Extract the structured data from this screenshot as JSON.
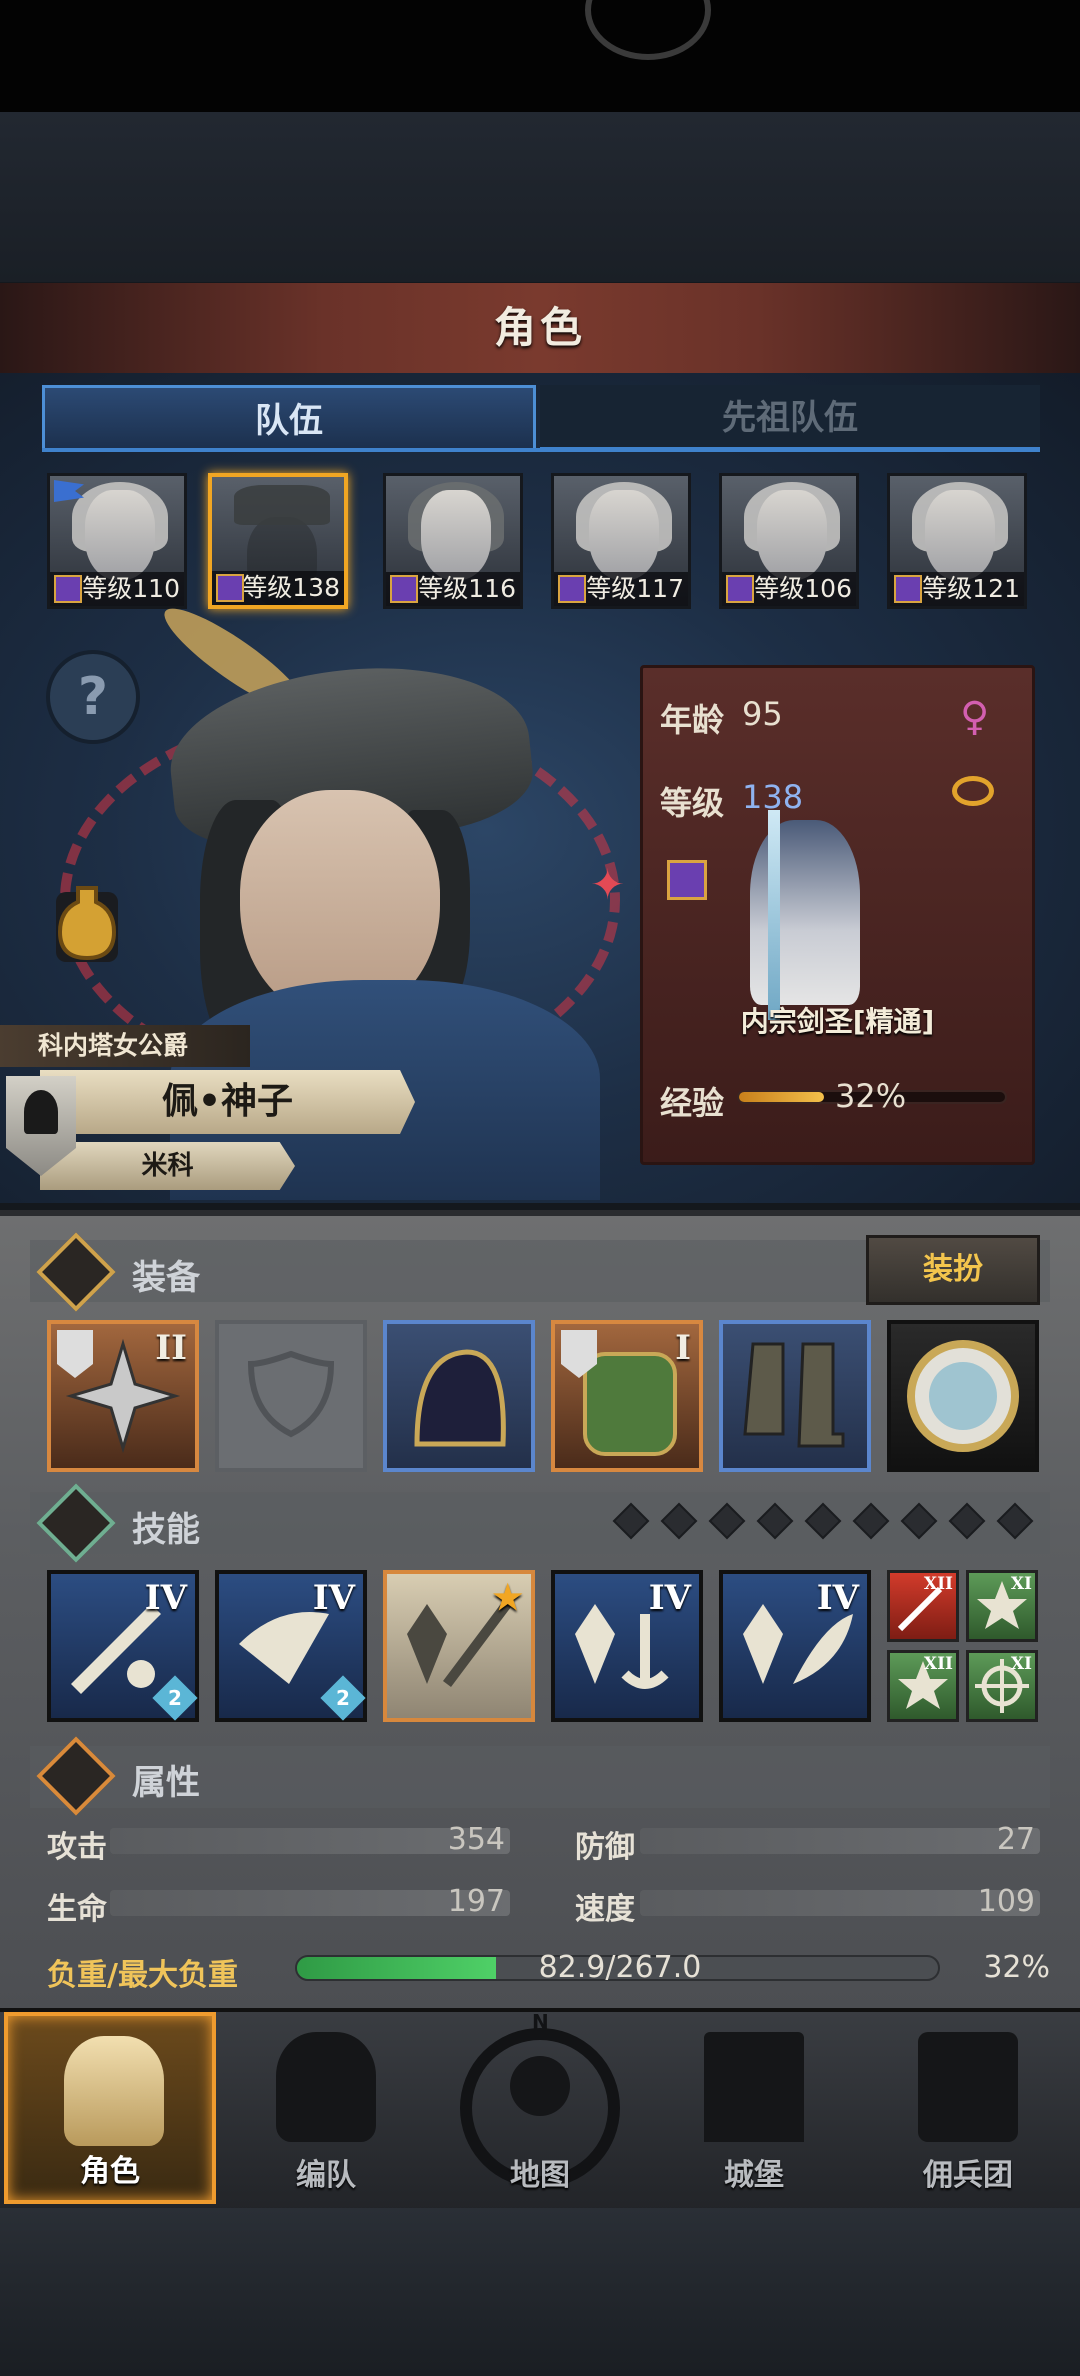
{
  "header": {
    "title": "角色"
  },
  "tabs": [
    {
      "label": "队伍",
      "active": true
    },
    {
      "label": "先祖队伍",
      "active": false
    }
  ],
  "roster": [
    {
      "level_text": "等级110",
      "selected": false,
      "flag": true
    },
    {
      "level_text": "等级138",
      "selected": true,
      "flag": false
    },
    {
      "level_text": "等级116",
      "selected": false,
      "flag": false
    },
    {
      "level_text": "等级117",
      "selected": false,
      "flag": false
    },
    {
      "level_text": "等级106",
      "selected": false,
      "flag": false
    },
    {
      "level_text": "等级121",
      "selected": false,
      "flag": false
    }
  ],
  "hero": {
    "title": "科内塔女公爵",
    "name": "佩•神子",
    "family": "米科",
    "help_icon": "?",
    "spark": "✦"
  },
  "info": {
    "age_label": "年龄",
    "age": "95",
    "gender_icon": "♀",
    "level_label": "等级",
    "level": "138",
    "class_name": "内宗剑圣[精通]",
    "exp_label": "经验",
    "exp_percent": "32%",
    "exp_fraction": 0.32
  },
  "equipment": {
    "title": "装备",
    "dress_button": "装扮",
    "slots": [
      {
        "icon": "cross-weapon-icon",
        "rank": "II",
        "rarity": "orange",
        "emblem": true
      },
      {
        "icon": "empty-shield-slot-icon",
        "rank": "",
        "rarity": "empty",
        "emblem": false
      },
      {
        "icon": "hood-icon",
        "rank": "",
        "rarity": "blue",
        "emblem": false
      },
      {
        "icon": "green-armor-icon",
        "rank": "I",
        "rarity": "orange",
        "emblem": true
      },
      {
        "icon": "boots-icon",
        "rank": "",
        "rarity": "blue",
        "emblem": false
      },
      {
        "icon": "medallion-icon",
        "rank": "",
        "rarity": "dark",
        "emblem": false
      }
    ]
  },
  "skills": {
    "title": "技能",
    "pips": 9,
    "slots": [
      {
        "icon": "sword-strike-skill-icon",
        "rank": "IV",
        "level": "2",
        "style": "blue"
      },
      {
        "icon": "blade-dash-skill-icon",
        "rank": "IV",
        "level": "2",
        "style": "blue"
      },
      {
        "icon": "crystal-spear-skill-icon",
        "rank": "★",
        "level": "",
        "style": "gold"
      },
      {
        "icon": "crystal-anchor-skill-icon",
        "rank": "IV",
        "level": "",
        "style": "blue"
      },
      {
        "icon": "crystal-wing-skill-icon",
        "rank": "IV",
        "level": "",
        "style": "blue"
      }
    ],
    "passives": [
      {
        "icon": "red-sword-passive-icon",
        "rank": "XII",
        "style": "red"
      },
      {
        "icon": "green-burst-passive-icon",
        "rank": "XI",
        "style": "green"
      },
      {
        "icon": "green-star-passive-icon",
        "rank": "XII",
        "style": "green"
      },
      {
        "icon": "target-passive-icon",
        "rank": "XI",
        "style": "green"
      }
    ]
  },
  "attributes": {
    "title": "属性",
    "attack_label": "攻击",
    "attack": "354",
    "defense_label": "防御",
    "defense": "27",
    "hp_label": "生命",
    "hp": "197",
    "speed_label": "速度",
    "speed": "109",
    "load_label": "负重/最大负重",
    "load_value": "82.9/267.0",
    "load_percent": "32%",
    "load_fraction": 0.31
  },
  "nav": [
    {
      "label": "角色",
      "icon": "knight-helmet-icon",
      "active": true
    },
    {
      "label": "编队",
      "icon": "formation-helmet-icon",
      "active": false
    },
    {
      "label": "地图",
      "icon": "compass-map-icon",
      "active": false
    },
    {
      "label": "城堡",
      "icon": "castle-icon",
      "active": false
    },
    {
      "label": "佣兵团",
      "icon": "mercenary-icon",
      "active": false
    }
  ],
  "colors": {
    "accent_gold": "#f1a623",
    "tab_blue": "#3f82cc",
    "load_green": "#4fd067",
    "exp_gold": "#f3c04b",
    "rarity_orange": "#d78840",
    "rarity_blue": "#5b86cd"
  }
}
